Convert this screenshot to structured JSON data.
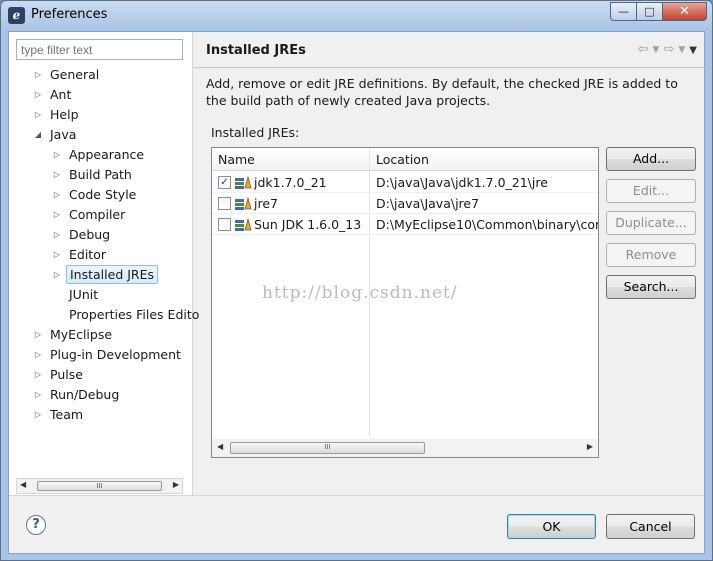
{
  "window": {
    "title": "Preferences",
    "controls": {
      "minimize": "—",
      "maximize": "□",
      "close": "✕"
    }
  },
  "sidebar": {
    "filter_placeholder": "type filter text",
    "items": [
      {
        "label": "General",
        "expanded": false,
        "level": 0
      },
      {
        "label": "Ant",
        "expanded": false,
        "level": 0
      },
      {
        "label": "Help",
        "expanded": false,
        "level": 0
      },
      {
        "label": "Java",
        "expanded": true,
        "level": 0
      },
      {
        "label": "Appearance",
        "expanded": false,
        "level": 1
      },
      {
        "label": "Build Path",
        "expanded": false,
        "level": 1
      },
      {
        "label": "Code Style",
        "expanded": false,
        "level": 1
      },
      {
        "label": "Compiler",
        "expanded": false,
        "level": 1
      },
      {
        "label": "Debug",
        "expanded": false,
        "level": 1
      },
      {
        "label": "Editor",
        "expanded": false,
        "level": 1
      },
      {
        "label": "Installed JREs",
        "expanded": false,
        "level": 1,
        "selected": true
      },
      {
        "label": "JUnit",
        "level": 1,
        "leaf": true
      },
      {
        "label": "Properties Files Edito",
        "level": 1,
        "leaf": true
      },
      {
        "label": "MyEclipse",
        "expanded": false,
        "level": 0
      },
      {
        "label": "Plug-in Development",
        "expanded": false,
        "level": 0
      },
      {
        "label": "Pulse",
        "expanded": false,
        "level": 0
      },
      {
        "label": "Run/Debug",
        "expanded": false,
        "level": 0
      },
      {
        "label": "Team",
        "expanded": false,
        "level": 0
      }
    ],
    "scroll_grip": "III"
  },
  "main": {
    "title": "Installed JREs",
    "description": "Add, remove or edit JRE definitions. By default, the checked JRE is added to the build path of newly created Java projects.",
    "table_label": "Installed JREs:",
    "columns": [
      "Name",
      "Location"
    ],
    "rows": [
      {
        "checked": true,
        "name": "jdk1.7.0_21",
        "location": "D:\\java\\Java\\jdk1.7.0_21\\jre"
      },
      {
        "checked": false,
        "name": "jre7",
        "location": "D:\\java\\Java\\jre7"
      },
      {
        "checked": false,
        "name": "Sun JDK 1.6.0_13",
        "location": "D:\\MyEclipse10\\Common\\binary\\com."
      }
    ],
    "scroll_grip": "III",
    "buttons": {
      "add": "Add...",
      "edit": "Edit...",
      "duplicate": "Duplicate...",
      "remove": "Remove",
      "search": "Search..."
    },
    "watermark": "http://blog.csdn.net/"
  },
  "footer": {
    "help": "?",
    "ok": "OK",
    "cancel": "Cancel"
  },
  "colors": {
    "selection": "#d6eaf9",
    "titlebar": "#a9c4e4",
    "close_button": "#c7412a"
  }
}
